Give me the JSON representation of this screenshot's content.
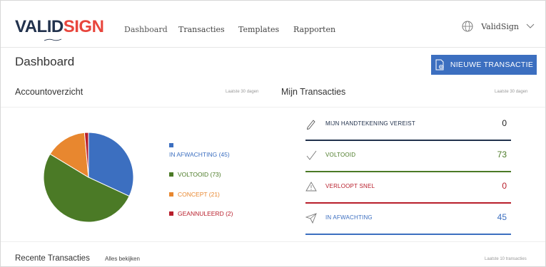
{
  "app": {
    "logo_valid": "VALID",
    "logo_sign": "SIGN"
  },
  "nav": {
    "items": [
      {
        "label": "Dashboard"
      },
      {
        "label": "Transacties"
      },
      {
        "label": "Templates"
      },
      {
        "label": "Rapporten"
      }
    ],
    "user": "ValidSign"
  },
  "page": {
    "title": "Dashboard",
    "new_button": "NIEUWE TRANSACTIE"
  },
  "accountoverzicht": {
    "title": "Accountoverzicht",
    "period": "Laatste 30 dagen",
    "legend": [
      {
        "label": "IN AFWACHTING (45)",
        "color": "#3c6fc0"
      },
      {
        "label": "VOLTOOID (73)",
        "color": "#4b7a26"
      },
      {
        "label": "CONCEPT (21)",
        "color": "#e8872f"
      },
      {
        "label": "GEANNULEERD (2)",
        "color": "#b81e2b"
      }
    ]
  },
  "chart_data": {
    "type": "pie",
    "categories": [
      "IN AFWACHTING",
      "VOLTOOID",
      "CONCEPT",
      "GEANNULEERD"
    ],
    "values": [
      45,
      73,
      21,
      2
    ],
    "colors": [
      "#3c6fc0",
      "#4b7a26",
      "#e8872f",
      "#b81e2b"
    ],
    "title": ""
  },
  "mijn_transacties": {
    "title": "Mijn Transacties",
    "period": "Laatste 30 dagen",
    "rows": [
      {
        "label": "MIJN HANDTEKENING VEREIST",
        "count": "0",
        "color": "#22324d",
        "icon": "pen-icon"
      },
      {
        "label": "VOLTOOID",
        "count": "73",
        "color": "#4b7a26",
        "icon": "check-icon"
      },
      {
        "label": "VERLOOPT SNEL",
        "count": "0",
        "color": "#b81e2b",
        "icon": "warning-icon"
      },
      {
        "label": "IN AFWACHTING",
        "count": "45",
        "color": "#3c6fc0",
        "icon": "send-icon"
      }
    ]
  },
  "recent": {
    "title": "Recente Transacties",
    "link": "Alles bekijken",
    "sub": "Laatste 10 transacties"
  }
}
